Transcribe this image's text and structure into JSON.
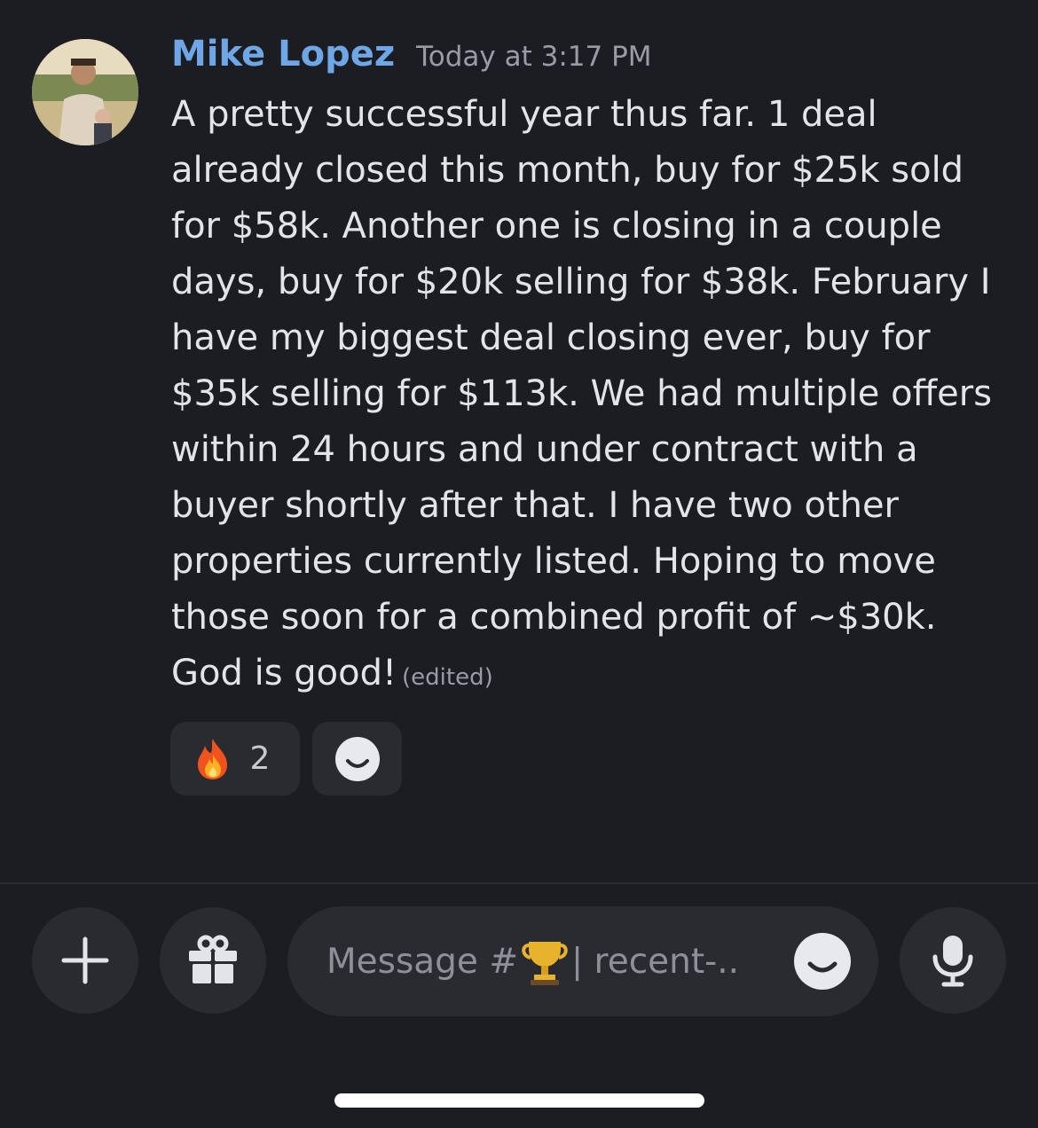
{
  "message": {
    "author": "Mike Lopez",
    "timestamp": "Today at 3:17 PM",
    "text": "A pretty successful year thus far. 1 deal\nalready closed this month, buy for $25k sold\nfor $58k. Another one is closing in a couple\ndays, buy for $20k selling for $38k. February I\nhave my biggest deal closing ever, buy for\n$35k selling for $113k. We had multiple offers\nwithin 24 hours and under contract with a\nbuyer shortly after that. I have two other\nproperties currently listed. Hoping to move\nthose soon for a combined profit of ~$30k.\nGod is good!",
    "edited_label": "(edited)"
  },
  "reactions": [
    {
      "emoji": "fire-icon",
      "count": "2"
    }
  ],
  "composer": {
    "placeholder_prefix": "Message #",
    "placeholder_suffix": " | recent-.."
  },
  "colors": {
    "background": "#1c1d22",
    "username": "#6fa6e6",
    "surface": "#2a2b31"
  }
}
